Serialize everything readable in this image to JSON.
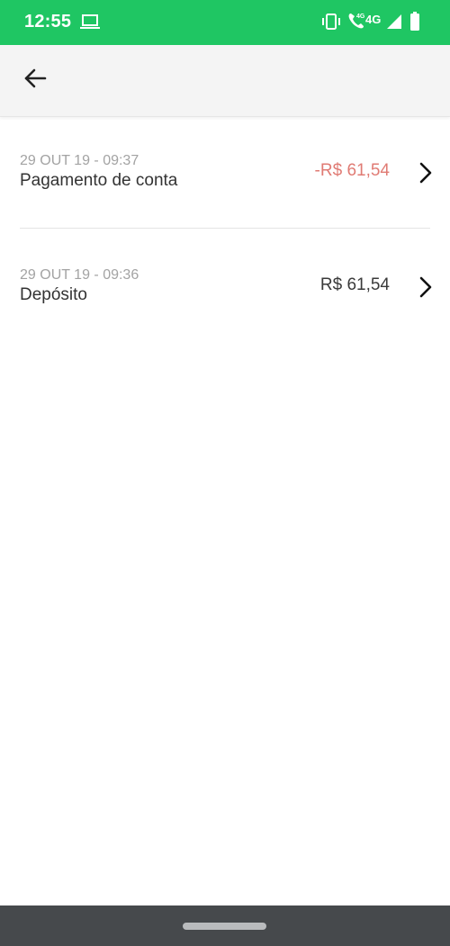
{
  "status_bar": {
    "time": "12:55",
    "network_label": "4G",
    "background_color": "#1fc663"
  },
  "app_bar": {
    "back_icon": "arrow-left-icon"
  },
  "transactions": [
    {
      "date": "29 OUT 19 - 09:37",
      "title": "Pagamento de conta",
      "amount": "-R$ 61,54",
      "amount_color": "#e07b74"
    },
    {
      "date": "29 OUT 19 - 09:36",
      "title": "Depósito",
      "amount": "R$ 61,54",
      "amount_color": "#3a3a3a"
    }
  ],
  "nav_bar": {
    "home_indicator": "home-pill"
  }
}
